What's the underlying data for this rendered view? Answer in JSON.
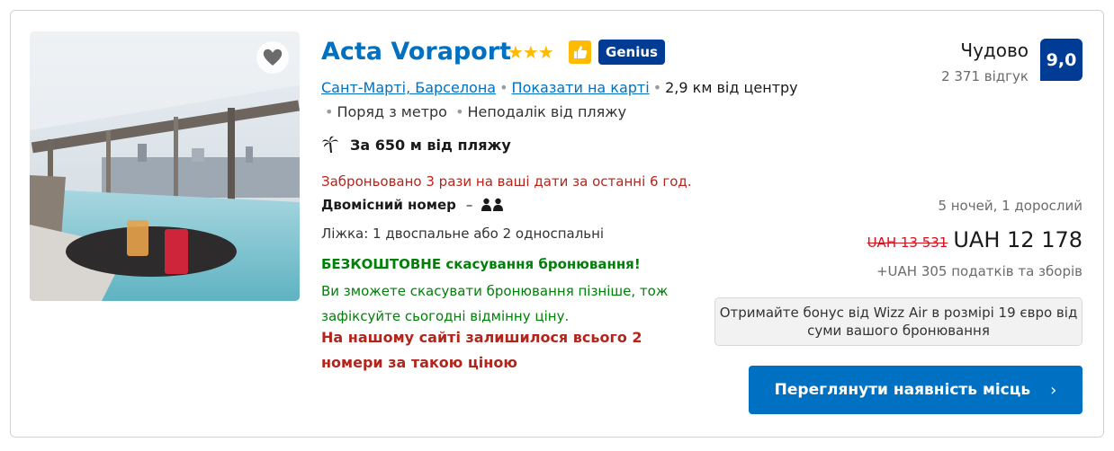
{
  "hotel": {
    "name": "Acta Voraport",
    "stars": "★★★",
    "badge": "Genius",
    "district_link": "Сант-Марті, Барселона",
    "map_link": "Показати на карті",
    "distance": "2,9 км від центру",
    "tags": [
      "Поряд з метро",
      "Неподалік від пляжу"
    ],
    "beach_distance": "За 650 м від пляжу"
  },
  "offer": {
    "booked_notice": "Заброньовано 3 рази на ваші дати за останні 6 год.",
    "room_name": "Двомісний номер",
    "room_separator": "–",
    "beds": "Ліжка: 1 двоспальне або 2 односпальні",
    "free_cancel": "БЕЗКОШТОВНЕ скасування бронювання!",
    "cancel_note": "Ви зможете скасувати бронювання пізніше, тож зафіксуйте сьогодні відмінну ціну.",
    "rooms_left": "На нашому сайті залишилося всього 2 номери за такою ціною"
  },
  "review": {
    "label": "Чудово",
    "count": "2 371 відгук",
    "score": "9,0"
  },
  "pricing": {
    "stay": "5 ночей, 1 дорослий",
    "old_price": "UAH 13 531",
    "new_price": "UAH 12 178",
    "taxes": "+UAH 305 податків та зборів"
  },
  "bonus_text": "Отримайте бонус від Wizz Air в розмірі 19 євро від суми вашого бронювання",
  "cta_label": "Переглянути наявність місць",
  "colors": {
    "link": "#0071c2",
    "genius": "#003b95",
    "green": "#008009",
    "red": "#b5241b",
    "star": "#febb02"
  }
}
